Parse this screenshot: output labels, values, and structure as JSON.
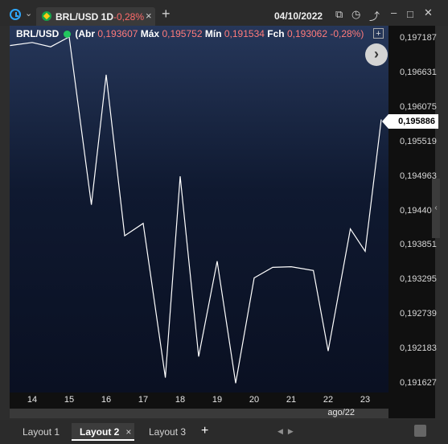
{
  "window": {
    "tab": {
      "symbol": "BRL/USD 1D",
      "change": "-0,28%"
    },
    "date": "04/10/2022",
    "icons": [
      "clock-icon",
      "chevron-down-icon",
      "brazil-flag-icon",
      "close-icon",
      "add-tab-icon",
      "copy-window-icon",
      "history-icon",
      "trend-icon",
      "minimize-icon",
      "maximize-icon",
      "close-window-icon"
    ]
  },
  "header": {
    "symbol": "BRL/USD",
    "open_label": "(Abr",
    "open": "0,193607",
    "high_label": "Máx",
    "high": "0,195752",
    "low_label": "Mín",
    "low": "0,191534",
    "close_label": "Fch",
    "close": "0,193062",
    "change": "-0,28%)"
  },
  "price_tag": "0,195886",
  "month_label": "ago/22",
  "chart_data": {
    "type": "line",
    "x": [
      "13.4",
      "14",
      "14.5",
      "15",
      "15.6",
      "16",
      "16.5",
      "17",
      "17.6",
      "18",
      "18.5",
      "19",
      "19.5",
      "20",
      "20.5",
      "21",
      "21.6",
      "22",
      "22.6",
      "23"
    ],
    "series": [
      {
        "values": [
          0.19708,
          0.19713,
          0.19706,
          0.19722,
          0.19451,
          0.19661,
          0.19401,
          0.19421,
          0.19172,
          0.19497,
          0.19206,
          0.1936,
          0.19163,
          0.19333,
          0.1935,
          0.19351,
          0.19345,
          0.19215,
          0.19412,
          0.19376
        ]
      }
    ],
    "last_value": 0.195886,
    "x_tick_labels": [
      "14",
      "15",
      "16",
      "17",
      "18",
      "19",
      "20",
      "21",
      "22",
      "23"
    ],
    "y_tick_labels": [
      "0,197187",
      "0,196631",
      "0,196075",
      "0,195519",
      "0,194963",
      "0,194407",
      "0,193851",
      "0,193295",
      "0,192739",
      "0,192183",
      "0,191627"
    ],
    "ylim": [
      0.19148,
      0.1974
    ],
    "colors": {
      "line": "#ffffff",
      "background_top": "#26375a",
      "background_bottom": "#0a1022"
    }
  },
  "bottom_tabs": [
    {
      "label": "Layout 1",
      "active": false
    },
    {
      "label": "Layout 2",
      "active": true
    },
    {
      "label": "Layout 3",
      "active": false
    }
  ]
}
